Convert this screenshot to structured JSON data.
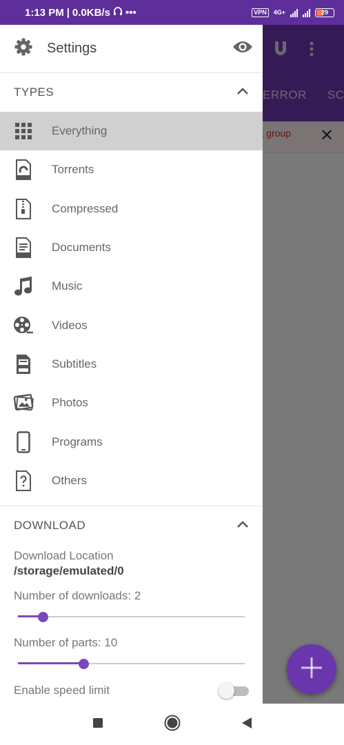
{
  "status_bar": {
    "time": "1:13 PM",
    "separator": "|",
    "speed": "0.0KB/s",
    "dots": "•••",
    "vpn": "VPN",
    "network": "4G+",
    "battery": "29"
  },
  "background_app": {
    "tabs": [
      "ERROR",
      "SCH"
    ],
    "banner_text": "ort group",
    "banner_close": "✕",
    "fab_icon": "plus-icon"
  },
  "drawer": {
    "header": {
      "title": "Settings",
      "icon": "gear-icon",
      "action_icon": "eye-icon"
    },
    "types_section": {
      "title": "TYPES",
      "items": [
        {
          "label": "Everything",
          "icon": "grid-icon",
          "active": true
        },
        {
          "label": "Torrents",
          "icon": "torrent-file-icon"
        },
        {
          "label": "Compressed",
          "icon": "zip-file-icon"
        },
        {
          "label": "Documents",
          "icon": "doc-file-icon"
        },
        {
          "label": "Music",
          "icon": "music-note-icon"
        },
        {
          "label": "Videos",
          "icon": "film-reel-icon"
        },
        {
          "label": "Subtitles",
          "icon": "subtitle-file-icon"
        },
        {
          "label": "Photos",
          "icon": "photos-icon"
        },
        {
          "label": "Programs",
          "icon": "phone-icon"
        },
        {
          "label": "Others",
          "icon": "question-file-icon"
        }
      ]
    },
    "download_section": {
      "title": "DOWNLOAD",
      "location_label": "Download Location",
      "location_value": "/storage/emulated/0",
      "downloads_label": "Number of downloads: 2",
      "downloads_fraction": 0.11,
      "parts_label": "Number of parts: 10",
      "parts_fraction": 0.29,
      "speed_limit_label": "Enable speed limit",
      "speed_limit_enabled": false
    }
  },
  "nav_bar": {
    "icons": [
      "recents-square-icon",
      "home-circle-icon",
      "back-triangle-icon"
    ]
  },
  "colors": {
    "primary": "#6a36ab",
    "status_bar": "#5e2f9a",
    "accent": "#7a48b8",
    "active_row": "#d0d0d0"
  }
}
